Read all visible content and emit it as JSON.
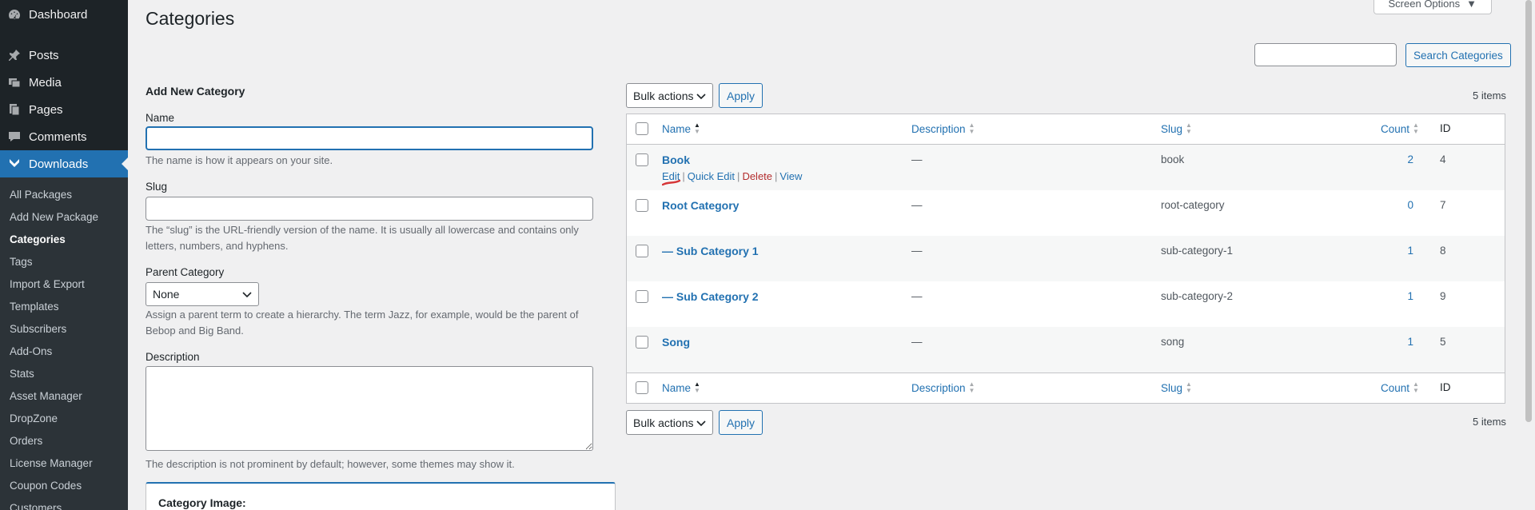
{
  "sidebar": {
    "top_items": [
      {
        "label": "Dashboard",
        "icon": "dashboard-icon"
      },
      {
        "label": "Posts",
        "icon": "pin-icon"
      },
      {
        "label": "Media",
        "icon": "media-icon"
      },
      {
        "label": "Pages",
        "icon": "pages-icon"
      },
      {
        "label": "Comments",
        "icon": "comment-icon"
      },
      {
        "label": "Downloads",
        "icon": "download-icon"
      }
    ],
    "sub_items": [
      "All Packages",
      "Add New Package",
      "Categories",
      "Tags",
      "Import & Export",
      "Templates",
      "Subscribers",
      "Add-Ons",
      "Stats",
      "Asset Manager",
      "DropZone",
      "Orders",
      "License Manager",
      "Coupon Codes",
      "Customers"
    ]
  },
  "header": {
    "title": "Categories",
    "screen_options": "Screen Options",
    "search_button": "Search Categories",
    "search_value": ""
  },
  "form": {
    "title": "Add New Category",
    "name_label": "Name",
    "name_value": "",
    "name_help": "The name is how it appears on your site.",
    "slug_label": "Slug",
    "slug_value": "",
    "slug_help": "The “slug” is the URL-friendly version of the name. It is usually all lowercase and contains only letters, numbers, and hyphens.",
    "parent_label": "Parent Category",
    "parent_value": "None",
    "parent_help": "Assign a parent term to create a hierarchy. The term Jazz, for example, would be the parent of Bebop and Big Band.",
    "description_label": "Description",
    "description_value": "",
    "description_help": "The description is not prominent by default; however, some themes may show it.",
    "image_label": "Category Image:"
  },
  "table": {
    "bulk_actions": "Bulk actions",
    "apply": "Apply",
    "items_count": "5 items",
    "columns": {
      "name": "Name",
      "description": "Description",
      "slug": "Slug",
      "count": "Count",
      "id": "ID"
    },
    "row_actions": {
      "edit": "Edit",
      "quick_edit": "Quick Edit",
      "delete": "Delete",
      "view": "View",
      "separator": "|"
    },
    "rows": [
      {
        "name": "Book",
        "description": "—",
        "slug": "book",
        "count": "2",
        "id": "4"
      },
      {
        "name": "Root Category",
        "description": "—",
        "slug": "root-category",
        "count": "0",
        "id": "7"
      },
      {
        "name": "— Sub Category 1",
        "description": "—",
        "slug": "sub-category-1",
        "count": "1",
        "id": "8"
      },
      {
        "name": "— Sub Category 2",
        "description": "—",
        "slug": "sub-category-2",
        "count": "1",
        "id": "9"
      },
      {
        "name": "Song",
        "description": "—",
        "slug": "song",
        "count": "1",
        "id": "5"
      }
    ]
  },
  "colors": {
    "sidebar": "#1d2327",
    "accent": "#2271b1",
    "delete": "#b32d2e",
    "annotation": "#d63638"
  }
}
